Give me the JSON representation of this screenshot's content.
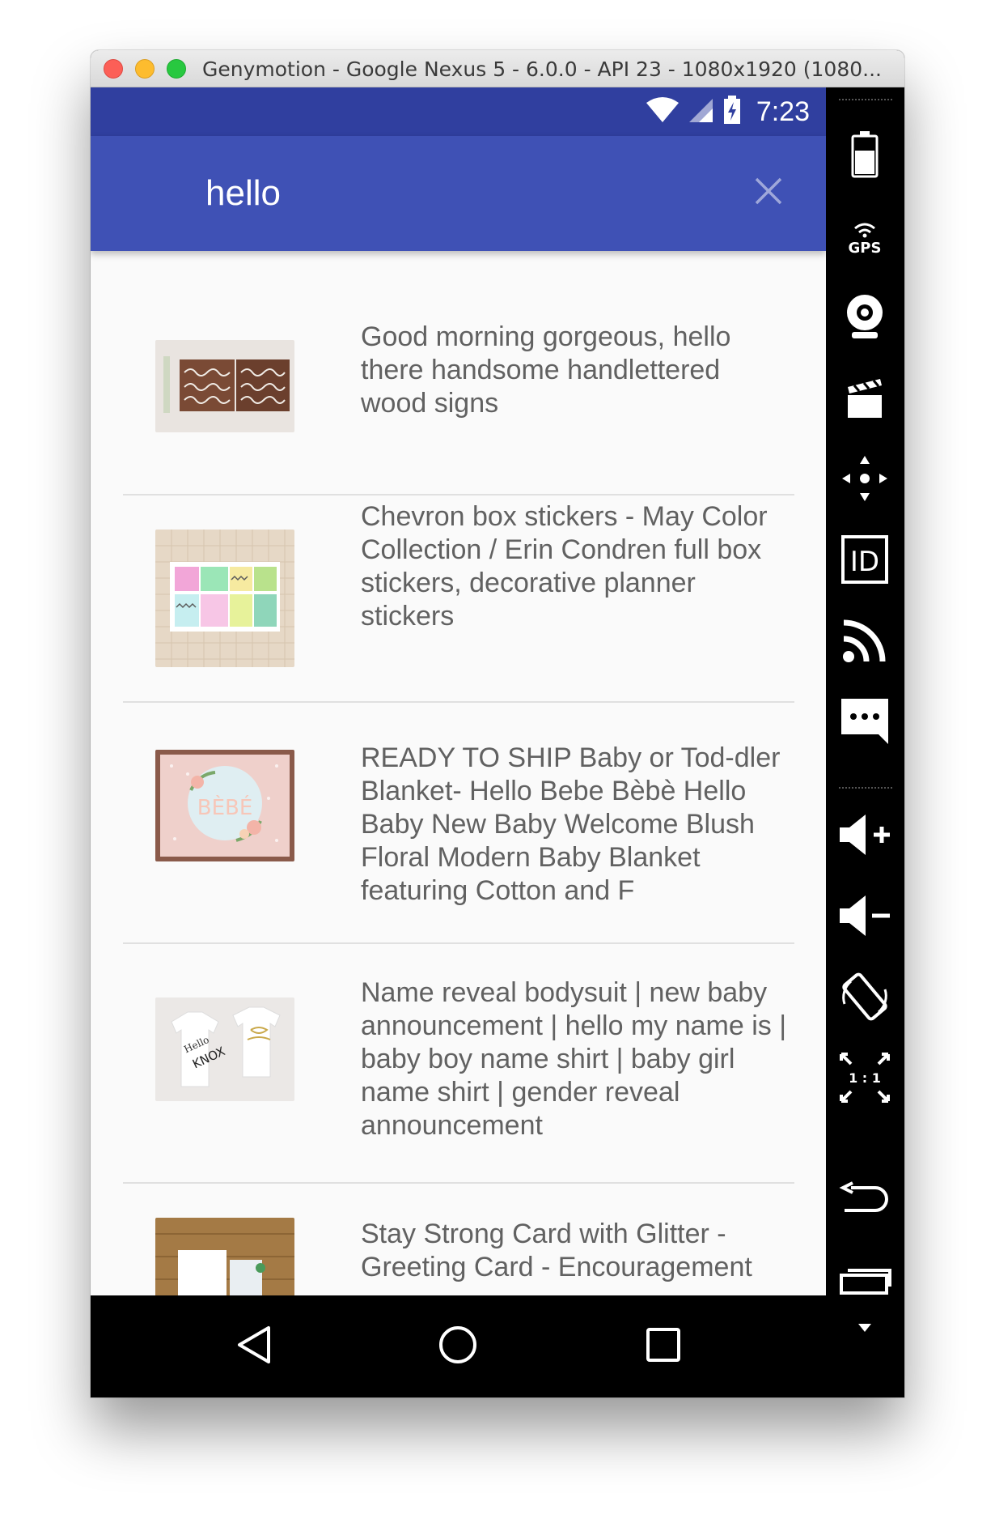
{
  "window": {
    "title": "Genymotion - Google Nexus 5 - 6.0.0 - API 23 - 1080x1920 (1080..."
  },
  "statusbar": {
    "time": "7:23"
  },
  "search": {
    "query": "hello"
  },
  "results": [
    {
      "title": "Good morning gorgeous, hello there handsome handlettered wood signs"
    },
    {
      "title": "Chevron box stickers - May Color Collection / Erin Condren full box stickers, decorative planner stickers"
    },
    {
      "title": "READY TO SHIP Baby or Tod-dler Blanket- Hello Bebe Bèbè Hello Baby New Baby Welcome Blush Floral Modern Baby Blanket featuring Cotton and F"
    },
    {
      "title": "Name reveal bodysuit | new baby announcement | hello my name is | baby boy name shirt | baby girl name shirt | gender reveal announcement"
    },
    {
      "title": "Stay Strong Card with Glitter - Greeting Card - Encouragement"
    }
  ],
  "thumb_text": {
    "bebe": "BÈBÉ",
    "hello_onesie": "Hello",
    "knox": "KNOX"
  },
  "sidebar": {
    "gps_label": "GPS",
    "id_label": "ID",
    "ratio_label": "1 : 1"
  },
  "colors": {
    "status_bar": "#303f9f",
    "toolbar": "#3f51b5",
    "list_bg": "#fafafa",
    "text": "#616161"
  }
}
